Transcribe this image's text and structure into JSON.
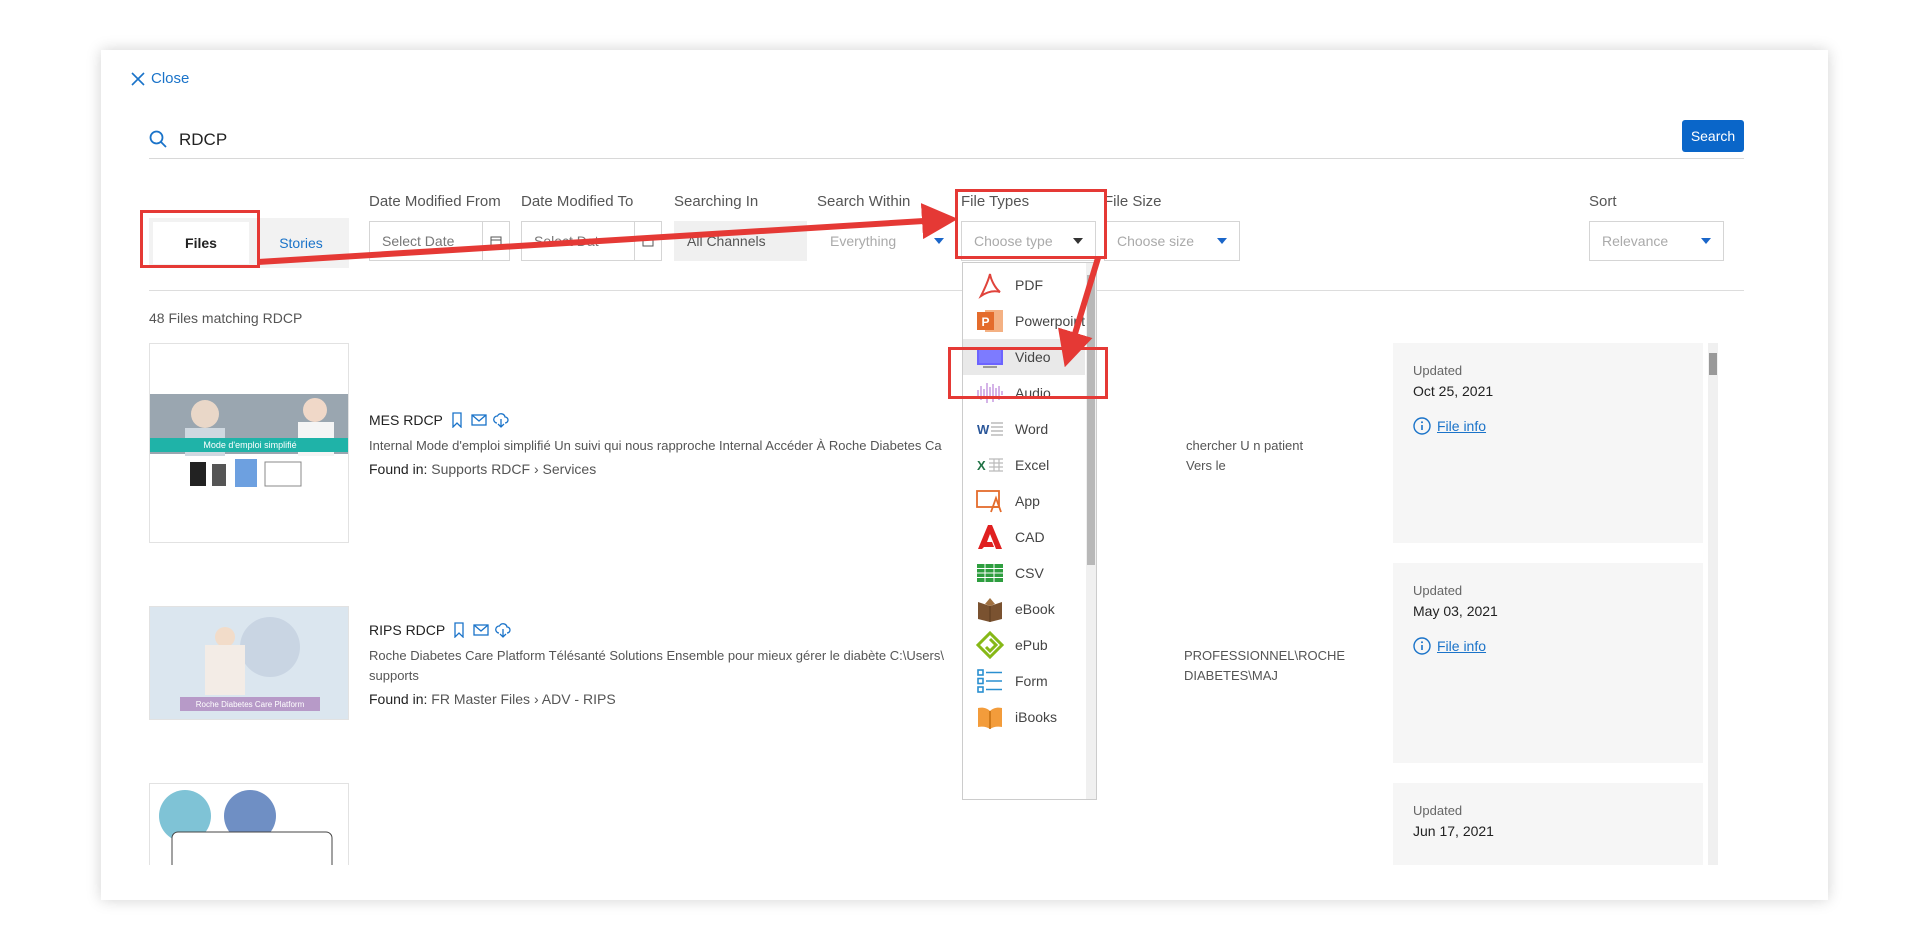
{
  "close_label": "Close",
  "search": {
    "query": "RDCP",
    "button": "Search"
  },
  "tabs": [
    {
      "label": "Files",
      "active": true
    },
    {
      "label": "Stories",
      "active": false
    }
  ],
  "filters": {
    "date_from": {
      "label": "Date Modified From",
      "placeholder": "Select Date"
    },
    "date_to": {
      "label": "Date Modified To",
      "placeholder": "Select Dat"
    },
    "searching_in": {
      "label": "Searching In",
      "value": "All Channels"
    },
    "search_within": {
      "label": "Search Within",
      "value": "Everything"
    },
    "file_types": {
      "label": "File Types",
      "placeholder": "Choose type"
    },
    "file_size": {
      "label": "File Size",
      "placeholder": "Choose size"
    },
    "sort": {
      "label": "Sort",
      "value": "Relevance"
    }
  },
  "results_count": "48 Files matching RDCP",
  "results": [
    {
      "title": "MES RDCP",
      "desc": "Internal Mode d'emploi simplifié Un suivi qui nous rapproche Internal Accéder À Roche Diabetes Ca",
      "desc_tail": "chercher U n patient Vers le",
      "found_label": "Found in:",
      "path": [
        "Supports RDCF",
        "Services"
      ],
      "updated_label": "Updated",
      "date": "Oct 25, 2021",
      "fileinfo": "File info",
      "thumb_text": "Mode d'emploi simplifié"
    },
    {
      "title": "RIPS RDCP",
      "desc": "Roche Diabetes Care Platform Télésanté Solutions Ensemble pour mieux gérer le diabète C:\\Users\\",
      "desc_tail": "PROFESSIONNEL\\ROCHE DIABETES\\MAJ",
      "desc_line2": "supports",
      "found_label": "Found in:",
      "path": [
        "FR Master Files",
        "ADV - RIPS"
      ],
      "updated_label": "Updated",
      "date": "May 03, 2021",
      "fileinfo": "File info",
      "thumb_text": "Roche Diabetes Care Platform"
    },
    {
      "updated_label": "Updated",
      "date": "Jun 17, 2021"
    }
  ],
  "path_separator": "›",
  "file_types_options": [
    {
      "label": "PDF",
      "icon": "pdf-icon"
    },
    {
      "label": "Powerpoint",
      "icon": "powerpoint-icon"
    },
    {
      "label": "Video",
      "icon": "video-icon",
      "highlighted": true
    },
    {
      "label": "Audio",
      "icon": "audio-icon"
    },
    {
      "label": "Word",
      "icon": "word-icon"
    },
    {
      "label": "Excel",
      "icon": "excel-icon"
    },
    {
      "label": "App",
      "icon": "app-icon"
    },
    {
      "label": "CAD",
      "icon": "cad-icon"
    },
    {
      "label": "CSV",
      "icon": "csv-icon"
    },
    {
      "label": "eBook",
      "icon": "ebook-icon"
    },
    {
      "label": "ePub",
      "icon": "epub-icon"
    },
    {
      "label": "Form",
      "icon": "form-icon"
    },
    {
      "label": "iBooks",
      "icon": "ibooks-icon"
    }
  ],
  "colors": {
    "accent": "#0a66c9",
    "annotation": "#e53935"
  }
}
